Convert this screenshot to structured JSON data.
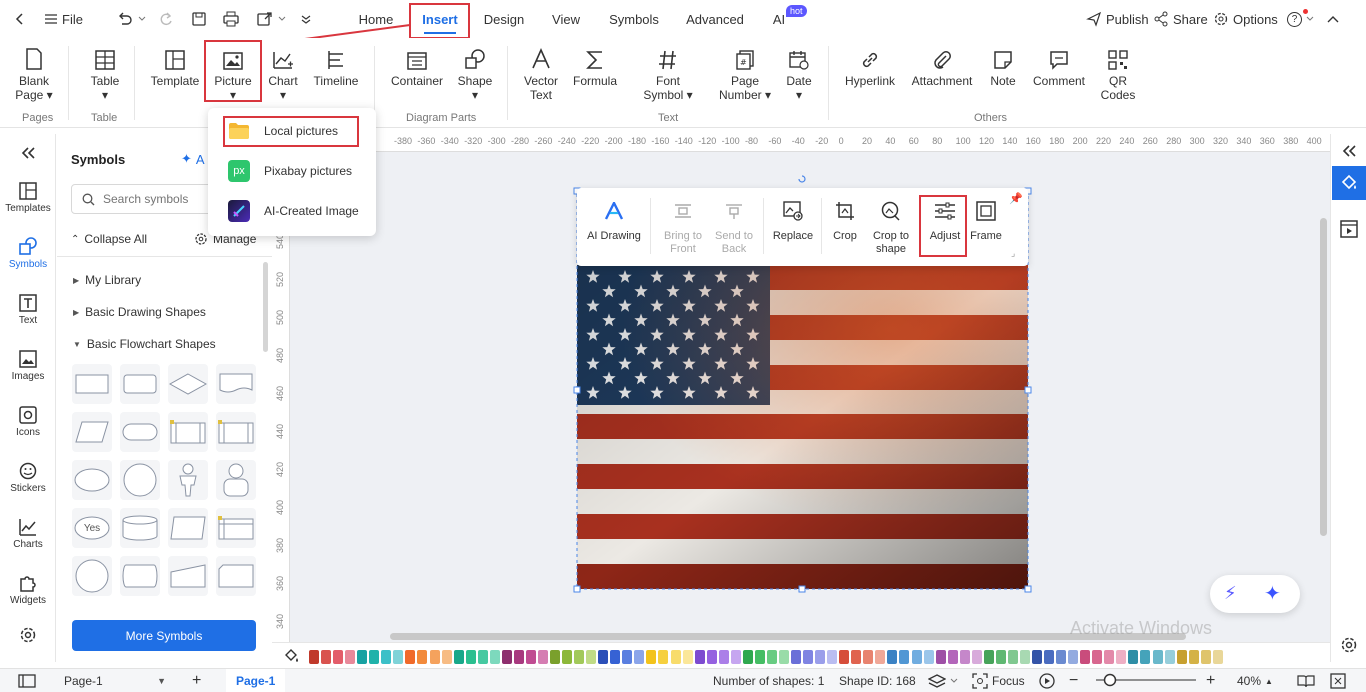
{
  "menubar": {
    "file": "File",
    "tabs": [
      "Home",
      "Insert",
      "Design",
      "View",
      "Symbols",
      "Advanced",
      "AI"
    ],
    "hot_badge": "hot",
    "publish": "Publish",
    "share": "Share",
    "options": "Options",
    "help": "?"
  },
  "ribbon": {
    "blank_page": [
      "Blank",
      "Page"
    ],
    "table": "Table",
    "template": "Template",
    "picture": "Picture",
    "chart": "Chart",
    "timeline": "Timeline",
    "container": "Container",
    "shape": "Shape",
    "vector_text": [
      "Vector",
      "Text"
    ],
    "formula": "Formula",
    "font_symbol": [
      "Font",
      "Symbol"
    ],
    "page_number": [
      "Page",
      "Number"
    ],
    "date": "Date",
    "hyperlink": "Hyperlink",
    "attachment": "Attachment",
    "note": "Note",
    "comment": "Comment",
    "qr_codes": [
      "QR",
      "Codes"
    ],
    "groups": [
      "Pages",
      "Table",
      "Diagram Parts",
      "Text",
      "Others"
    ]
  },
  "picture_menu": [
    "Local pictures",
    "Pixabay pictures",
    "AI-Created Image"
  ],
  "rail": [
    "Templates",
    "Symbols",
    "Text",
    "Images",
    "Icons",
    "Stickers",
    "Charts",
    "Widgets"
  ],
  "symbols_panel": {
    "title": "Symbols",
    "ai_label": "A",
    "search_placeholder": "Search symbols",
    "collapse_all": "Collapse All",
    "manage": "Manage",
    "libraries": [
      "My Library",
      "Basic Drawing Shapes",
      "Basic Flowchart Shapes"
    ],
    "yes_shape": "Yes",
    "more_symbols": "More Symbols"
  },
  "ruler": {
    "h_ticks": [
      "-380",
      "-360",
      "-340",
      "-320",
      "-300",
      "-280",
      "-260",
      "-240",
      "-220",
      "-200",
      "-180",
      "-160",
      "-140",
      "-120",
      "-100",
      "-80",
      "-60",
      "-40",
      "-20",
      "0",
      "20",
      "40",
      "60",
      "80",
      "100",
      "120",
      "140",
      "160",
      "180",
      "200",
      "220",
      "240",
      "260",
      "280",
      "300",
      "320",
      "340",
      "360",
      "380",
      "400",
      "420",
      "440",
      "460",
      "480",
      "500",
      "520",
      "540"
    ],
    "v_ticks": [
      "540",
      "520",
      "500",
      "480",
      "460",
      "440",
      "420",
      "400",
      "380",
      "360",
      "340",
      "320"
    ]
  },
  "floating_toolbar": {
    "ai_drawing": "AI Drawing",
    "bring_to_front": [
      "Bring to",
      "Front"
    ],
    "send_to_back": [
      "Send to",
      "Back"
    ],
    "replace": "Replace",
    "crop": "Crop",
    "crop_to_shape": [
      "Crop to",
      "shape"
    ],
    "adjust": "Adjust",
    "frame": "Frame"
  },
  "colors": {
    "accent": "#1f6fe5",
    "highlight": "#d9363e",
    "flag_blue": "#1e3a5c",
    "flag_red": "#a8301f"
  },
  "watermark": "Activate Windows",
  "statusbar": {
    "page_select": "Page-1",
    "page_tab": "Page-1",
    "shape_count": "Number of shapes: 1",
    "shape_id": "Shape ID: 168",
    "focus": "Focus",
    "zoom": "40%"
  }
}
